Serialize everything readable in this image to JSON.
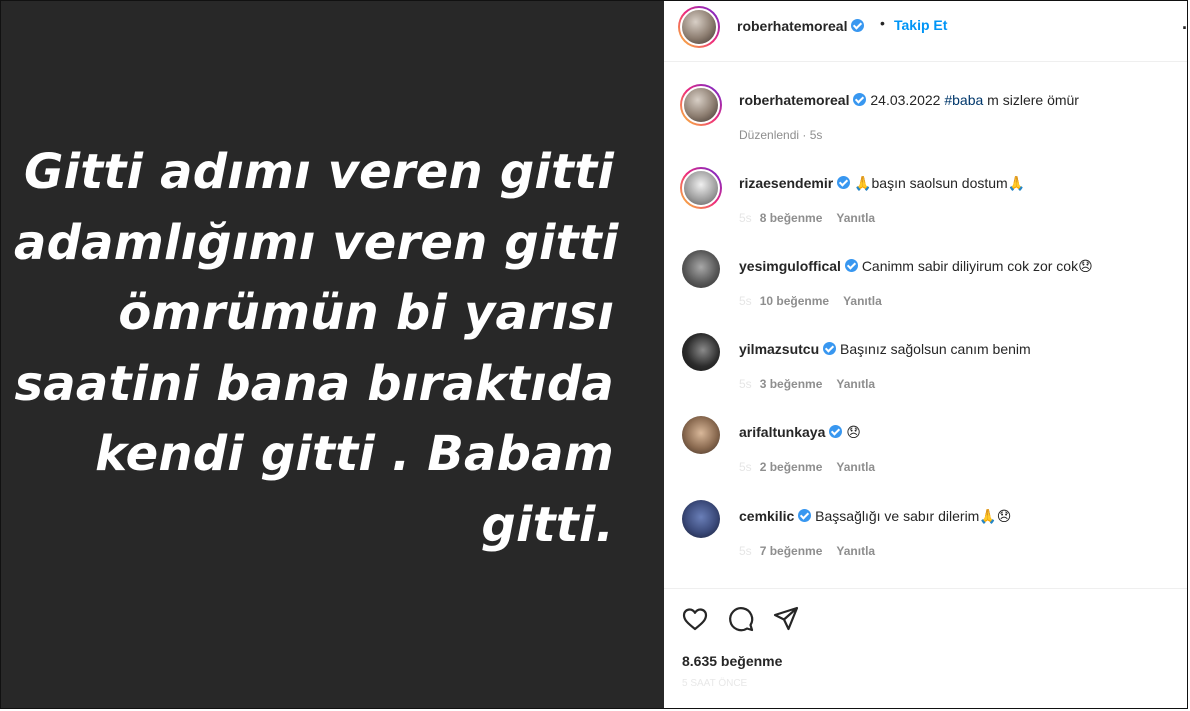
{
  "media": {
    "lines": [
      "Gitti adımı veren  gitti",
      "adamlığımı veren gitti",
      "ömrümün bi yarısı",
      "saatini bana bıraktıda",
      "kendi gitti . Babam",
      "gitti."
    ]
  },
  "header": {
    "username": "roberhatemoreal",
    "separator": "•",
    "follow_label": "Takip Et",
    "more_label": "..."
  },
  "caption": {
    "username": "roberhatemoreal",
    "text_before": "24.03.2022 ",
    "hashtag": "#baba",
    "text_after": " m sizlere ömür",
    "edited": "Düzenlendi",
    "dot": "·",
    "time": "5s"
  },
  "comments": [
    {
      "username": "rizaesendemir",
      "text": "başın saolsun dostum",
      "emoji_before": "🙏",
      "emoji_after": "🙏",
      "time": "5s",
      "likes": "8 beğenme",
      "reply": "Yanıtla",
      "avatar_color": "#c9c9c9"
    },
    {
      "username": "yesimgulоffical",
      "text": "Canimm sabir diliyirum cok zor cok",
      "emoji_before": "",
      "emoji_after": "😞",
      "time": "5s",
      "likes": "10 beğenme",
      "reply": "Yanıtla",
      "avatar_color": "#6b6b6b"
    },
    {
      "username": "yilmazsutcu",
      "text": "Başınız sağolsun canım benim",
      "emoji_before": "",
      "emoji_after": "",
      "time": "5s",
      "likes": "3 beğenme",
      "reply": "Yanıtla",
      "avatar_color": "#3d3d3d"
    },
    {
      "username": "arifaltunkaya",
      "text": "",
      "emoji_before": "",
      "emoji_after": "😞",
      "time": "5s",
      "likes": "2 beğenme",
      "reply": "Yanıtla",
      "avatar_color": "#8a6a50"
    },
    {
      "username": "cemkilic",
      "text": "Başsağlığı ve sabır dilerim",
      "emoji_before": "",
      "emoji_after": "🙏😞",
      "time": "5s",
      "likes": "7 beğenme",
      "reply": "Yanıtla",
      "avatar_color": "#3b4a7a"
    }
  ],
  "actions": {
    "like_icon": "heart-icon",
    "comment_icon": "comment-icon",
    "share_icon": "share-icon",
    "likes_count": "8.635 beğenme",
    "time_ago": "5 SAAT ÖNCE"
  },
  "colors": {
    "media_bg": "#282828",
    "accent": "#0095f6",
    "verified": "#3897f0"
  }
}
